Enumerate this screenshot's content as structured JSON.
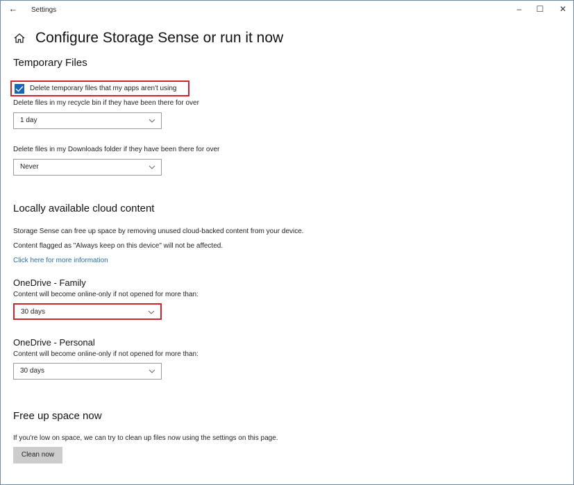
{
  "titlebar": {
    "app_title": "Settings",
    "back_glyph": "←",
    "minimize_glyph": "–",
    "maximize_glyph": "☐",
    "close_glyph": "✕"
  },
  "page": {
    "title": "Configure Storage Sense or run it now"
  },
  "temporary_files": {
    "heading": "Temporary Files",
    "checkbox_label": "Delete temporary files that my apps aren't using",
    "checkbox_checked": true,
    "recycle_label": "Delete files in my recycle bin if they have been there for over",
    "recycle_value": "1 day",
    "downloads_label": "Delete files in my Downloads folder if they have been there for over",
    "downloads_value": "Never"
  },
  "cloud": {
    "heading": "Locally available cloud content",
    "desc1": "Storage Sense can free up space by removing unused cloud-backed content from your device.",
    "desc2": "Content flagged as \"Always keep on this device\" will not be affected.",
    "link": "Click here for more information",
    "family_heading": "OneDrive - Family",
    "family_label": "Content will become online-only if not opened for more than:",
    "family_value": "30 days",
    "personal_heading": "OneDrive - Personal",
    "personal_label": "Content will become online-only if not opened for more than:",
    "personal_value": "30 days"
  },
  "free_up": {
    "heading": "Free up space now",
    "desc": "If you're low on space, we can try to clean up files now using the settings on this page.",
    "button": "Clean now"
  },
  "colors": {
    "accent": "#1565b8",
    "highlight_border": "#d2232a",
    "link": "#2a6ea6"
  }
}
